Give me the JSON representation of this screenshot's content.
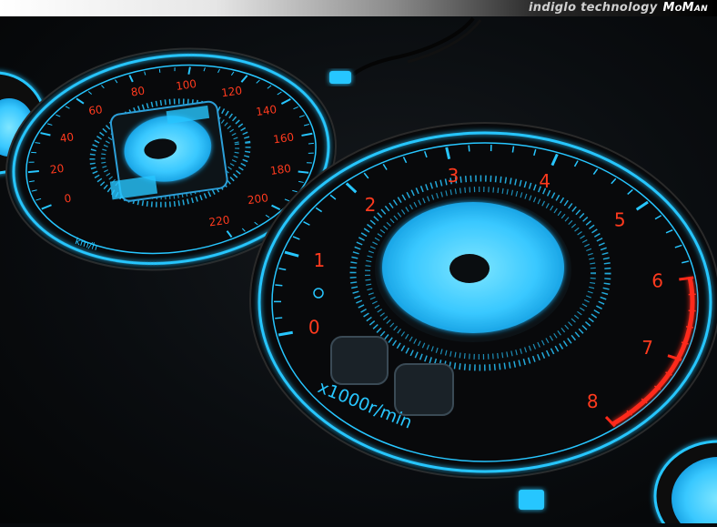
{
  "banner": {
    "text": "indiglo technology",
    "brand": "MoMan"
  },
  "speedometer": {
    "labels": [
      "0",
      "20",
      "40",
      "60",
      "80",
      "100",
      "120",
      "140",
      "160",
      "180",
      "200",
      "220"
    ],
    "unit": "km/h"
  },
  "tachometer": {
    "labels": [
      "0",
      "1",
      "2",
      "3",
      "4",
      "5",
      "6",
      "7",
      "8"
    ],
    "unit": "x1000r/min"
  },
  "colors": {
    "glow": "#27c6ff",
    "face": "#08090b",
    "numerals": "#ff3a1e",
    "redline": "#ff2a1a"
  }
}
